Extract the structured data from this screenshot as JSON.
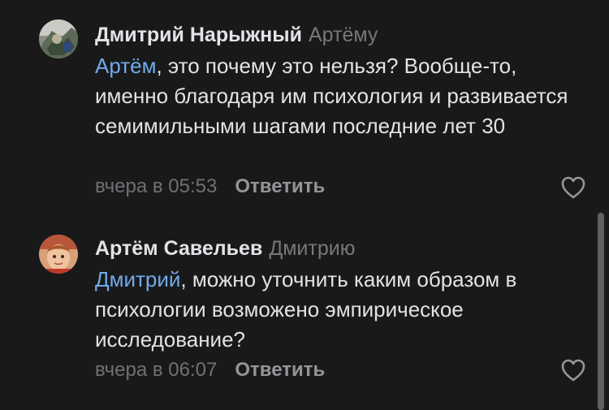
{
  "comments": [
    {
      "author": "Дмитрий Нарыжный",
      "reply_to": "Артёму",
      "mention": "Артём",
      "text": ", это почему это нельзя? Вообще-то, именно благодаря им психология и развивается семимильными шагами последние лет 30",
      "time": "вчера в 05:53",
      "reply_label": "Ответить",
      "avatar_icon": "user-photo-icon",
      "like_icon": "heart-outline-icon"
    },
    {
      "author": "Артём Савельев",
      "reply_to": "Дмитрию",
      "mention": "Дмитрий",
      "text": ", можно уточнить каким образом в психологии возможено эмпирическое исследование?",
      "time": "вчера в 06:07",
      "reply_label": "Ответить",
      "avatar_icon": "user-photo-icon",
      "like_icon": "heart-outline-icon"
    }
  ],
  "colors": {
    "background": "#19191a",
    "primary_text": "#e1e3e6",
    "secondary_text": "#76787a",
    "mention": "#71aaeb",
    "scrollbar": "#5f6063"
  }
}
